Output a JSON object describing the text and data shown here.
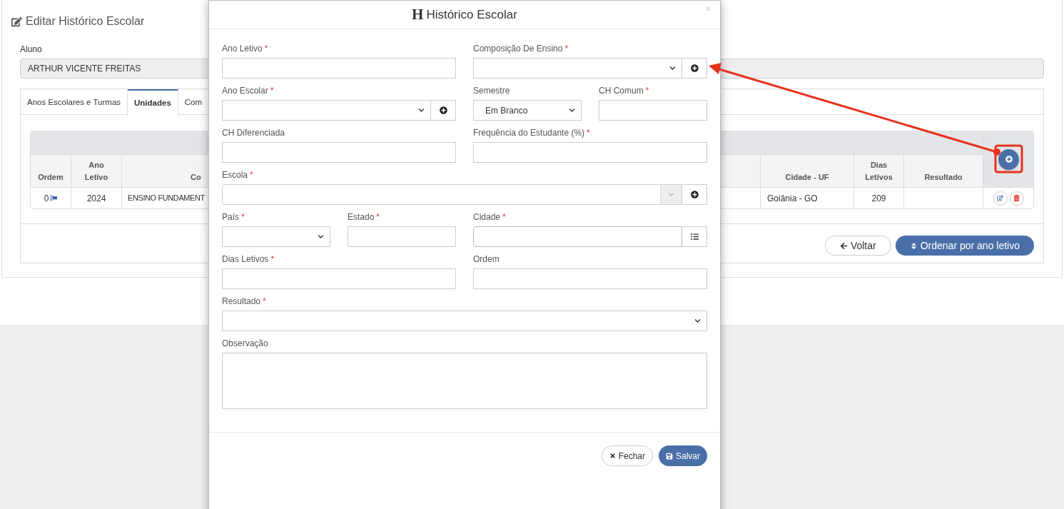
{
  "page": {
    "title": "Editar Histórico Escolar",
    "student_label": "Aluno",
    "student_value": "ARTHUR VICENTE FREITAS",
    "tabs": [
      {
        "label": "Anos Escolares e Turmas",
        "selected": false
      },
      {
        "label": "Unidades",
        "selected": true
      },
      {
        "label": "Com",
        "selected": false
      }
    ],
    "table": {
      "columns": [
        "Ordem",
        "Ano Letivo",
        "Co",
        "Cidade - UF",
        "Dias Letivos",
        "Resultado"
      ],
      "rows": [
        {
          "cells": [
            "0",
            "2024",
            "ENSINO FUNDAMENT",
            "Goiânia - GO",
            "209",
            ""
          ],
          "flagged": true
        }
      ]
    },
    "buttons": [
      {
        "label": "Voltar",
        "kind": "back"
      },
      {
        "label": "Ordenar por ano letivo",
        "kind": "sort"
      }
    ]
  },
  "modal": {
    "title_glyph": "H",
    "title": "Histórico Escolar",
    "close": "×",
    "rows": [
      {
        "left": [
          {
            "label": "Ano Letivo",
            "marker": "*",
            "kind": "text"
          }
        ],
        "right": [
          {
            "label": "Composição De Ensino",
            "marker": "*",
            "kind": "select_add"
          }
        ]
      },
      {
        "left": [
          {
            "label": "Ano Escolar",
            "marker": "*",
            "kind": "select_add"
          }
        ],
        "right": [
          {
            "label": "Semestre",
            "kind": "select",
            "value": "Em Branco"
          },
          {
            "label": "CH Comum",
            "marker": "*",
            "kind": "text"
          }
        ]
      },
      {
        "left": [
          {
            "label": "CH Diferenciada",
            "kind": "text"
          }
        ],
        "right": [
          {
            "label": "Frequência do Estudante (%)",
            "marker": "*",
            "kind": "text"
          }
        ]
      },
      {
        "full": [
          {
            "label": "Escola",
            "marker": "*",
            "kind": "combo_add"
          }
        ]
      },
      {
        "left": [
          {
            "label": "País",
            "marker": "*",
            "kind": "select"
          },
          {
            "label": "Estado",
            "marker": "*",
            "kind": "text"
          }
        ],
        "right": [
          {
            "label": "Cidade",
            "marker": "*",
            "kind": "text_list"
          }
        ]
      },
      {
        "left": [
          {
            "label": "Dias Letivos",
            "marker": "*",
            "kind": "text"
          }
        ],
        "right": [
          {
            "label": "Ordem",
            "kind": "text"
          }
        ]
      },
      {
        "full": [
          {
            "label": "Resultado",
            "marker": "*",
            "kind": "select"
          }
        ]
      },
      {
        "full": [
          {
            "label": "Observação",
            "kind": "textarea"
          }
        ]
      }
    ],
    "buttons": [
      {
        "label": "Fechar",
        "kind": "close"
      },
      {
        "label": "Salvar",
        "kind": "save"
      }
    ]
  }
}
